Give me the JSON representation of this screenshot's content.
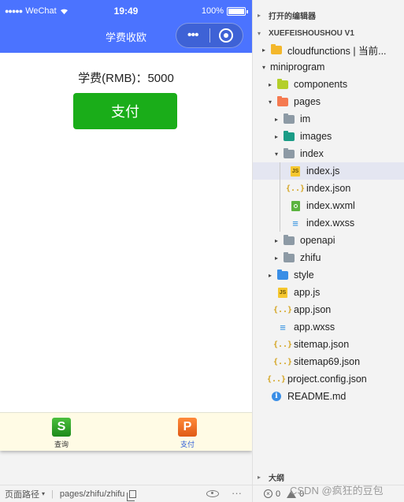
{
  "simulator": {
    "status": {
      "carrier": "WeChat",
      "time": "19:49",
      "battery": "100%"
    },
    "nav_title": "学费收欧",
    "fee_label": "学费(RMB)：",
    "fee_value": "5000",
    "pay_button": "支付",
    "tabs": [
      {
        "label": "查询",
        "icon_char": "S",
        "icon_name": "query-tab-icon",
        "selected": false
      },
      {
        "label": "支付",
        "icon_char": "P",
        "icon_name": "pay-tab-icon",
        "selected": true
      }
    ],
    "bottom_bar": {
      "page_path_label": "页面路径",
      "page_path": "pages/zhifu/zhifu"
    }
  },
  "explorer": {
    "open_editors": "打开的编辑器",
    "project": "XUEFEISHOUSHOU V1",
    "tree": [
      {
        "label": "cloudfunctions | 当前...",
        "twisty": "▸",
        "icon": "folder-yellow"
      },
      {
        "label": "miniprogram",
        "twisty": "▾",
        "icon": "none"
      },
      {
        "label": "components",
        "twisty": "▸",
        "icon": "folder-lime"
      },
      {
        "label": "pages",
        "twisty": "▾",
        "icon": "folder-orange"
      },
      {
        "label": "im",
        "twisty": "▸",
        "icon": "folder-grey"
      },
      {
        "label": "images",
        "twisty": "▸",
        "icon": "folder-teal"
      },
      {
        "label": "index",
        "twisty": "▾",
        "icon": "folder-grey"
      },
      {
        "label": "index.js",
        "twisty": "",
        "icon": "js",
        "selected": true
      },
      {
        "label": "index.json",
        "twisty": "",
        "icon": "json"
      },
      {
        "label": "index.wxml",
        "twisty": "",
        "icon": "wxml"
      },
      {
        "label": "index.wxss",
        "twisty": "",
        "icon": "css"
      },
      {
        "label": "openapi",
        "twisty": "▸",
        "icon": "folder-grey"
      },
      {
        "label": "zhifu",
        "twisty": "▸",
        "icon": "folder-grey"
      },
      {
        "label": "style",
        "twisty": "▸",
        "icon": "folder-blue"
      },
      {
        "label": "app.js",
        "twisty": "",
        "icon": "js"
      },
      {
        "label": "app.json",
        "twisty": "",
        "icon": "json"
      },
      {
        "label": "app.wxss",
        "twisty": "",
        "icon": "css"
      },
      {
        "label": "sitemap.json",
        "twisty": "",
        "icon": "json"
      },
      {
        "label": "sitemap69.json",
        "twisty": "",
        "icon": "json"
      },
      {
        "label": "project.config.json",
        "twisty": "",
        "icon": "json"
      },
      {
        "label": "README.md",
        "twisty": "",
        "icon": "info"
      }
    ],
    "outline": "大纲",
    "status": {
      "errors": "0",
      "warnings": "0"
    },
    "watermark": "CSDN @疯狂的豆包"
  },
  "colors": {
    "nav_blue": "#4b73ff",
    "pay_green": "#1aad19",
    "selected_row": "#e4e6f1",
    "tab_active": "#2a5bd7"
  }
}
